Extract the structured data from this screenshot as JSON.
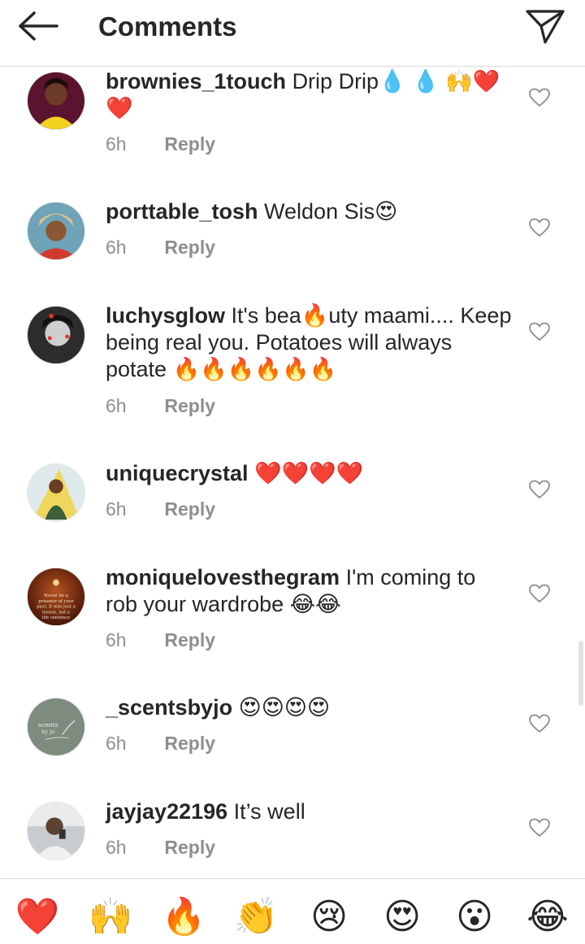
{
  "header": {
    "title": "Comments"
  },
  "comments": [
    {
      "username": "brownies_1touch",
      "text": "Drip Drip💧 💧  🙌❤️ ❤️",
      "time": "6h",
      "reply": "Reply"
    },
    {
      "username": "porttable_tosh",
      "text": "Weldon Sis😍",
      "time": "6h",
      "reply": "Reply"
    },
    {
      "username": "luchysglow",
      "text": "It's bea🔥uty maami.... Keep being real you. Potatoes will always potate 🔥🔥🔥🔥🔥🔥",
      "time": "6h",
      "reply": "Reply"
    },
    {
      "username": "uniquecrystal",
      "text": "❤️❤️❤️❤️",
      "time": "6h",
      "reply": "Reply"
    },
    {
      "username": "moniquelovesthegram",
      "text": "I'm coming to rob your wardrobe 😂😂",
      "time": "6h",
      "reply": "Reply",
      "avatar_text": "Never be a prisoner of your past. It was just a lesson, not a life sentence"
    },
    {
      "username": "_scentsbyjo",
      "text": "😍😍😍😍",
      "time": "6h",
      "reply": "Reply",
      "avatar_text": "scents by jo"
    },
    {
      "username": "jayjay22196",
      "text": "It’s well",
      "time": "6h",
      "reply": "Reply"
    }
  ],
  "reactions": [
    "❤️",
    "🙌",
    "🔥",
    "👏",
    "😢",
    "😍",
    "😮",
    "😂"
  ],
  "icons": {
    "back": "arrow-left-icon",
    "send": "paper-plane-icon",
    "like": "heart-outline-icon"
  },
  "colors": {
    "text": "#262626",
    "secondary": "#8e8e8e",
    "divider": "#dbdbdb"
  }
}
